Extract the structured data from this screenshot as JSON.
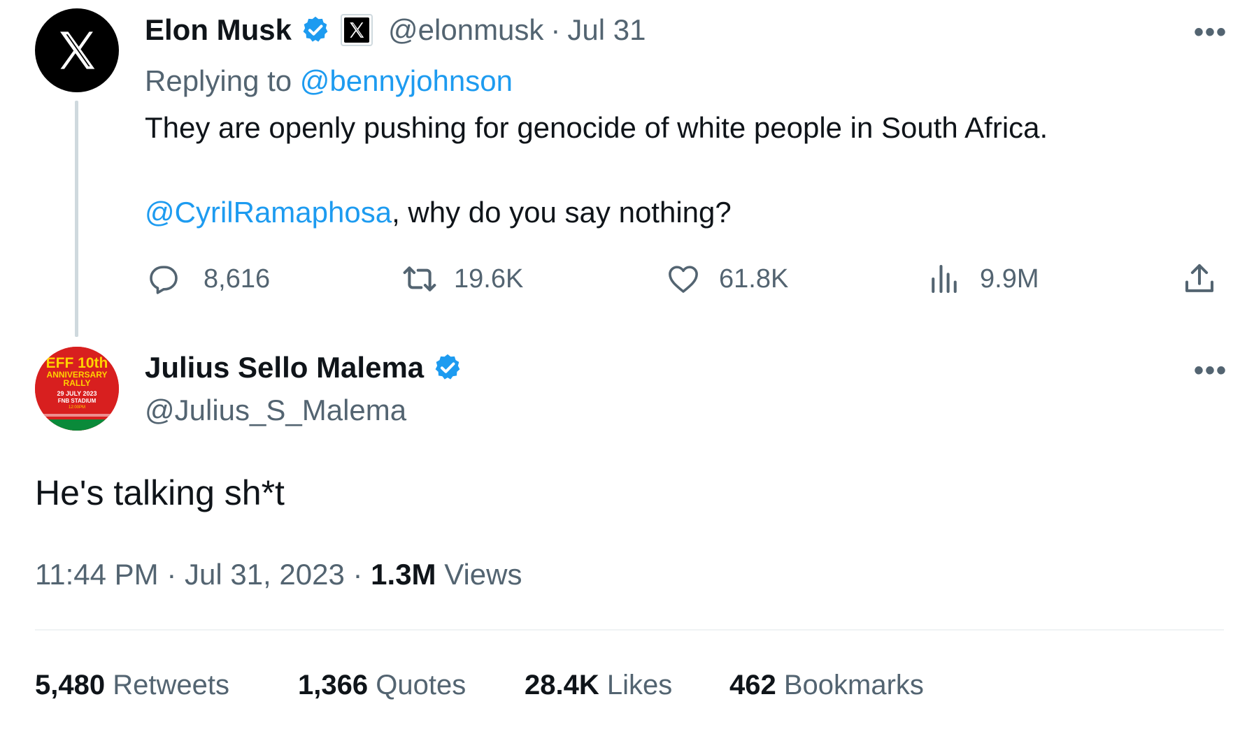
{
  "parent_tweet": {
    "author_name": "Elon Musk",
    "handle": "@elonmusk",
    "date": "Jul 31",
    "replying_to_prefix": "Replying to ",
    "replying_to_handle": "@bennyjohnson",
    "text_line1": "They are openly pushing for genocide of white people in South Africa.",
    "mention": "@CyrilRamaphosa",
    "text_line2_rest": ", why do you say nothing?",
    "actions": {
      "replies": "8,616",
      "retweets": "19.6K",
      "likes": "61.8K",
      "views": "9.9M"
    },
    "more": "•••"
  },
  "main_tweet": {
    "author_name": "Julius Sello Malema",
    "handle": "@Julius_S_Malema",
    "text": "He's talking sh*t",
    "time": "11:44 PM",
    "date": "Jul 31, 2023",
    "views_count": "1.3M",
    "views_label": "Views",
    "more": "•••",
    "avatar_text": {
      "line1": "EFF 10th",
      "line2": "ANNIVERSARY",
      "line3": "RALLY",
      "line4": "29 JULY 2023",
      "line5": "FNB STADIUM",
      "line6": "12:00PM"
    }
  },
  "stats": {
    "retweets_count": "5,480",
    "retweets_label": "Retweets",
    "quotes_count": "1,366",
    "quotes_label": "Quotes",
    "likes_count": "28.4K",
    "likes_label": "Likes",
    "bookmarks_count": "462",
    "bookmarks_label": "Bookmarks"
  },
  "colors": {
    "link": "#1d9bf0",
    "muted": "#536471",
    "text": "#0f1419",
    "verified": "#1d9bf0"
  },
  "icons": [
    "x-logo-icon",
    "verified-badge-icon",
    "x-affiliate-badge-icon",
    "reply-icon",
    "retweet-icon",
    "like-icon",
    "views-icon",
    "share-icon",
    "more-icon"
  ]
}
